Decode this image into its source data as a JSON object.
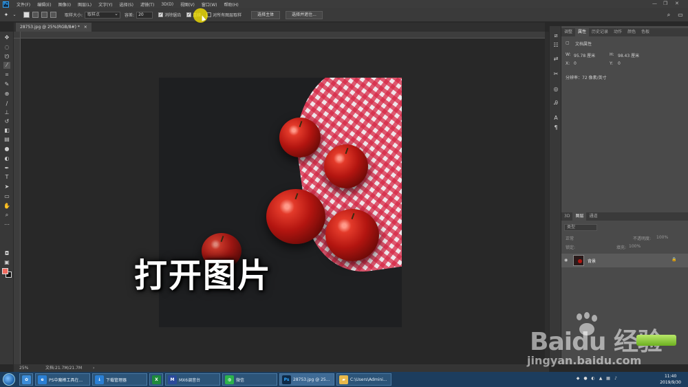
{
  "menubar": {
    "logo": "Ps",
    "items": [
      "文件(F)",
      "编辑(E)",
      "图像(I)",
      "图层(L)",
      "文字(Y)",
      "选择(S)",
      "滤镜(T)",
      "3D(D)",
      "视图(V)",
      "窗口(W)",
      "帮助(H)"
    ],
    "window_controls": [
      "—",
      "❐",
      "✕"
    ]
  },
  "options_bar": {
    "sample_size_label": "取样大小:",
    "sample_size_value": "取样点",
    "tolerance_label": "容差:",
    "tolerance_value": "20",
    "antialias_label": "消除锯齿",
    "contiguous_label": "连续",
    "sample_all_label": "对所有图层取样",
    "select_subject_button": "选择主体",
    "select_and_mask_button": "选择并遮住..."
  },
  "document_tab": {
    "title": "28753.jpg @ 25%(RGB/8#) *",
    "close": "×"
  },
  "overlay_title": "打开图片",
  "status_bar": {
    "zoom": "25%",
    "doc_info": "文档:21.7M/21.7M",
    "arrow": "›"
  },
  "right_panel": {
    "top_tabs": [
      "调整",
      "属性",
      "历史记录",
      "动作",
      "颜色",
      "色板"
    ],
    "active_top_tab": "属性",
    "section_title": "文档属性",
    "width_label": "W:",
    "width_value": "95.78 厘米",
    "height_label": "H:",
    "height_value": "98.43 厘米",
    "x_label": "X:",
    "x_value": "0",
    "y_label": "Y:",
    "y_value": "0",
    "resolution": "分辨率：72 像素/英寸",
    "layer_tabs": [
      "3D",
      "图层",
      "通道"
    ],
    "active_layer_tab": "图层",
    "kind_filter": "类型",
    "blend_mode": "正常",
    "opacity_label": "不透明度:",
    "opacity_value": "100%",
    "lock_label": "锁定:",
    "fill_label": "填充:",
    "fill_value": "100%",
    "layer_name": "背景"
  },
  "watermark": {
    "brand": "Baidu 经验",
    "url": "jingyan.baidu.com"
  },
  "taskbar": {
    "items": [
      {
        "label": "PS中魔棒工具在...",
        "icon": "browser-icon",
        "color": "#2a7fd4"
      },
      {
        "label": "下载管理器",
        "icon": "download-icon",
        "color": "#2a7fd4"
      },
      {
        "label": "",
        "icon": "excel-icon",
        "color": "#1d8a3c"
      },
      {
        "label": "MX6调音台",
        "icon": "mixer-icon",
        "color": "#2a4a9a"
      },
      {
        "label": "微信",
        "icon": "wechat-icon",
        "color": "#2bb24c"
      },
      {
        "label": "28753.jpg @ 25...",
        "icon": "photoshop-icon",
        "color": "#0e2a47"
      },
      {
        "label": "C:\\Users\\Admini...",
        "icon": "folder-icon",
        "color": "#e8b84a"
      }
    ],
    "time": "11:40",
    "date": "2019/9/30"
  }
}
